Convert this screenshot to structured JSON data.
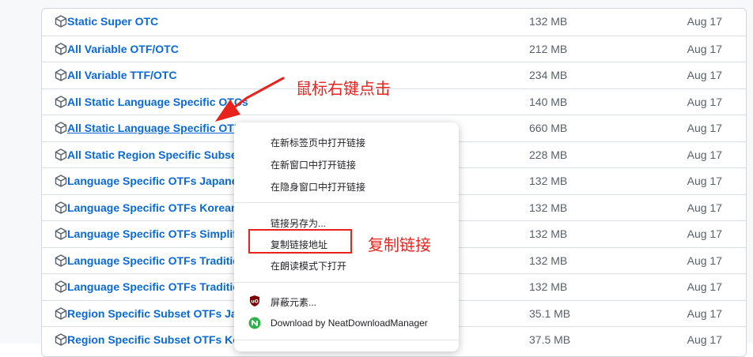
{
  "assets": [
    {
      "name": "Static Super OTC",
      "size": "132 MB",
      "date": "Aug 17"
    },
    {
      "name": "All Variable OTF/OTC",
      "size": "212 MB",
      "date": "Aug 17"
    },
    {
      "name": "All Variable TTF/OTC",
      "size": "234 MB",
      "date": "Aug 17"
    },
    {
      "name": "All Static Language Specific OTCs",
      "size": "140 MB",
      "date": "Aug 17"
    },
    {
      "name": "All Static Language Specific OTFs",
      "size": "660 MB",
      "date": "Aug 17"
    },
    {
      "name": "All Static Region Specific Subset OTFs",
      "size": "228 MB",
      "date": "Aug 17"
    },
    {
      "name": "Language Specific OTFs Japanese",
      "size": "132 MB",
      "date": "Aug 17"
    },
    {
      "name": "Language Specific OTFs Korean (",
      "size": "132 MB",
      "date": "Aug 17"
    },
    {
      "name": "Language Specific OTFs Simplified",
      "size": "132 MB",
      "date": "Aug 17"
    },
    {
      "name": "Language Specific OTFs Traditional",
      "size": "132 MB",
      "date": "Aug 17"
    },
    {
      "name": "Language Specific OTFs Traditional",
      "size": "132 MB",
      "date": "Aug 17"
    },
    {
      "name": "Region Specific Subset OTFs Japanese",
      "size": "35.1 MB",
      "date": "Aug 17"
    },
    {
      "name": "Region Specific Subset OTFs Korean",
      "size": "37.5 MB",
      "date": "Aug 17"
    }
  ],
  "context_menu": {
    "open_new_tab": "在新标签页中打开链接",
    "open_new_window": "在新窗口中打开链接",
    "open_incognito": "在隐身窗口中打开链接",
    "save_link_as": "链接另存为...",
    "copy_link_address": "复制链接地址",
    "open_reading_mode": "在朗读模式下打开",
    "block_element": "屏蔽元素...",
    "download_ndm": "Download by NeatDownloadManager"
  },
  "annotations": {
    "right_click_label": "鼠标右键点击",
    "copy_link_label": "复制链接"
  },
  "colors": {
    "link": "#0969da",
    "annotation": "#e8231e",
    "ublock": "#800000",
    "ndm": "#2fb24c"
  }
}
